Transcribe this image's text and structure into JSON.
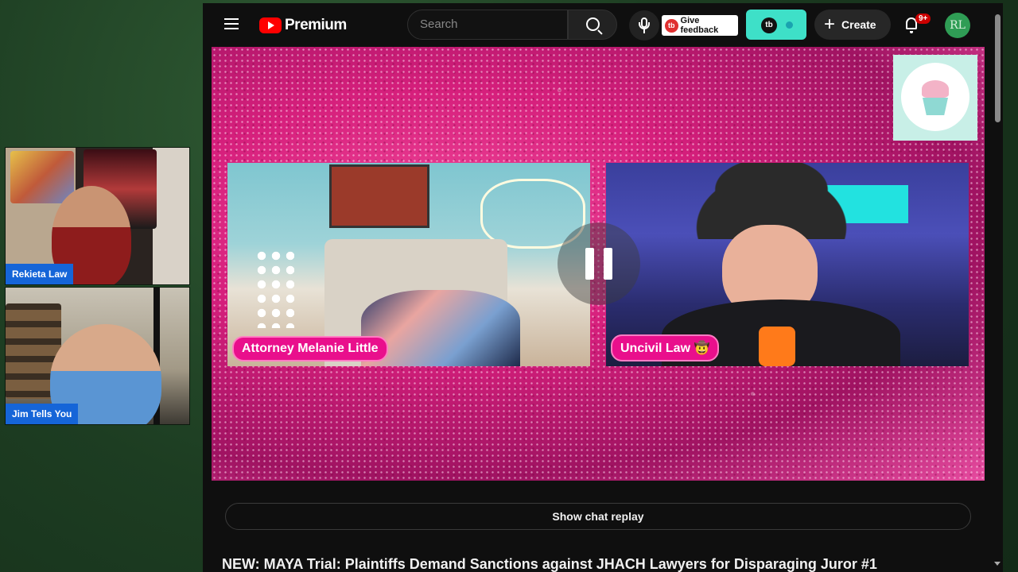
{
  "left_cams": [
    {
      "name": "Rekieta Law"
    },
    {
      "name": "Jim Tells You"
    }
  ],
  "header": {
    "logo_text": "Premium",
    "search_placeholder": "Search",
    "feedback_label": "Give feedback",
    "feedback_icon_text": "tb",
    "extension_icon_text": "tb",
    "create_label": "Create",
    "notification_count": "9+",
    "avatar_text": "RL"
  },
  "icons": {
    "menu": "menu-icon",
    "search": "search-icon",
    "mic": "microphone-icon",
    "bell": "bell-icon",
    "plus": "plus-icon",
    "pause": "pause-icon"
  },
  "player": {
    "left_tile_label": "Attorney Melanie Little",
    "right_tile_label": "Uncivil Law 🤠",
    "state": "playing"
  },
  "below_player": {
    "chat_replay_label": "Show chat replay",
    "video_title": "NEW: MAYA Trial: Plaintiffs Demand Sanctions against JHACH Lawyers for Disparaging Juror #1"
  },
  "colors": {
    "accent_red": "#ff0000",
    "tile_label_pink": "#e90f8c",
    "cam_tag_blue": "#1565d8",
    "extension_teal": "#3ee0c8"
  }
}
